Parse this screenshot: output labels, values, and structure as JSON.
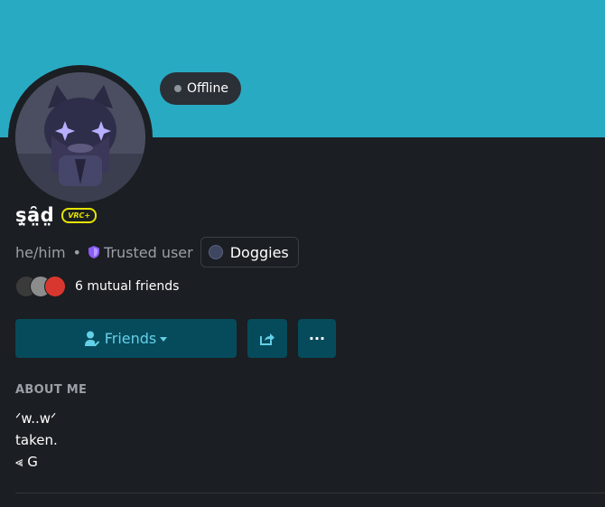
{
  "profile": {
    "status": "Offline",
    "display_name": "ş̤ȃ̤d̤",
    "badge": "VRC+",
    "pronouns": "he/him",
    "separator": "•",
    "trust_rank": "Trusted user",
    "group": "Doggies",
    "mutual_friends": "6 mutual friends"
  },
  "actions": {
    "friends_label": "Friends",
    "more_label": "···"
  },
  "about": {
    "title": "ABOUT ME",
    "body": "ᐟw..wᐟ\ntaken.\n⪡ G"
  },
  "colors": {
    "banner": "#29aac3",
    "background": "#1b1e22",
    "button_bg": "#064b5c",
    "button_fg": "#64d0e8",
    "badge": "#e5e500",
    "trust_shield": "#8a5cf6"
  },
  "icons": [
    "user-check-icon",
    "caret-down-icon",
    "share-icon",
    "more-icon",
    "shield-icon",
    "status-dot-icon"
  ]
}
